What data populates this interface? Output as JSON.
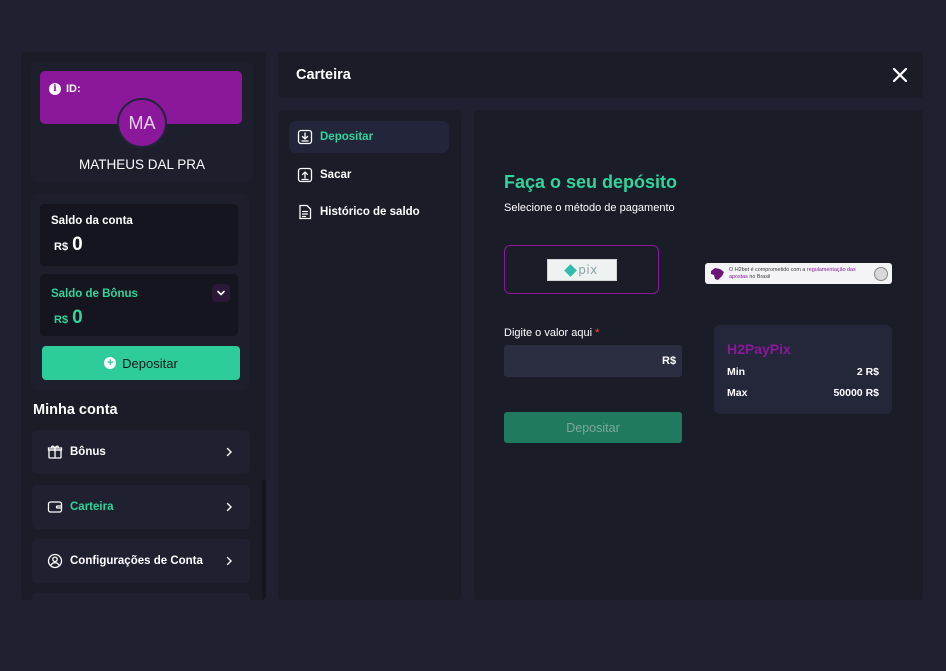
{
  "colors": {
    "background": "#1f2131",
    "panel": "#1a1c28",
    "accent_green": "#2fd59a",
    "brand_purple": "#8b179a",
    "button_green": "#2ecc9a"
  },
  "profile": {
    "id_label": "ID:",
    "avatar_initials": "MA",
    "name": "MATHEUS DAL PRA"
  },
  "balances": {
    "account_label": "Saldo da conta",
    "account_currency": "R$",
    "account_value": "0",
    "bonus_label": "Saldo de Bônus",
    "bonus_currency": "R$",
    "bonus_value": "0"
  },
  "sidebar": {
    "deposit_button": "Depositar",
    "section_title": "Minha conta",
    "items": [
      {
        "label": "Bônus",
        "icon": "gift-icon",
        "active": false
      },
      {
        "label": "Carteira",
        "icon": "wallet-icon",
        "active": true
      },
      {
        "label": "Configurações de Conta",
        "icon": "user-settings-icon",
        "active": false
      },
      {
        "label": "",
        "icon": "",
        "active": false
      }
    ]
  },
  "header": {
    "title": "Carteira",
    "close_icon": "close-icon"
  },
  "wallet_nav": {
    "items": [
      {
        "label": "Depositar",
        "icon": "download-icon",
        "active": true
      },
      {
        "label": "Sacar",
        "icon": "upload-icon",
        "active": false
      },
      {
        "label": "Histórico de saldo",
        "icon": "document-icon",
        "active": false
      }
    ]
  },
  "deposit": {
    "title": "Faça o seu depósito",
    "subtitle": "Selecione o método de pagamento",
    "method_logo_text": "pix",
    "regulation_text_prefix": "O H2bet é comprometido com a ",
    "regulation_text_highlight": "regulamentação das apostas",
    "regulation_text_suffix": " no Brasil",
    "amount_label": "Digite o valor aqui",
    "amount_required_mark": "*",
    "amount_value": "",
    "amount_currency": "R$",
    "submit_label": "Depositar"
  },
  "limits": {
    "provider": "H2PayPix",
    "min_label": "Min",
    "min_value": "2 R$",
    "max_label": "Max",
    "max_value": "50000 R$"
  }
}
